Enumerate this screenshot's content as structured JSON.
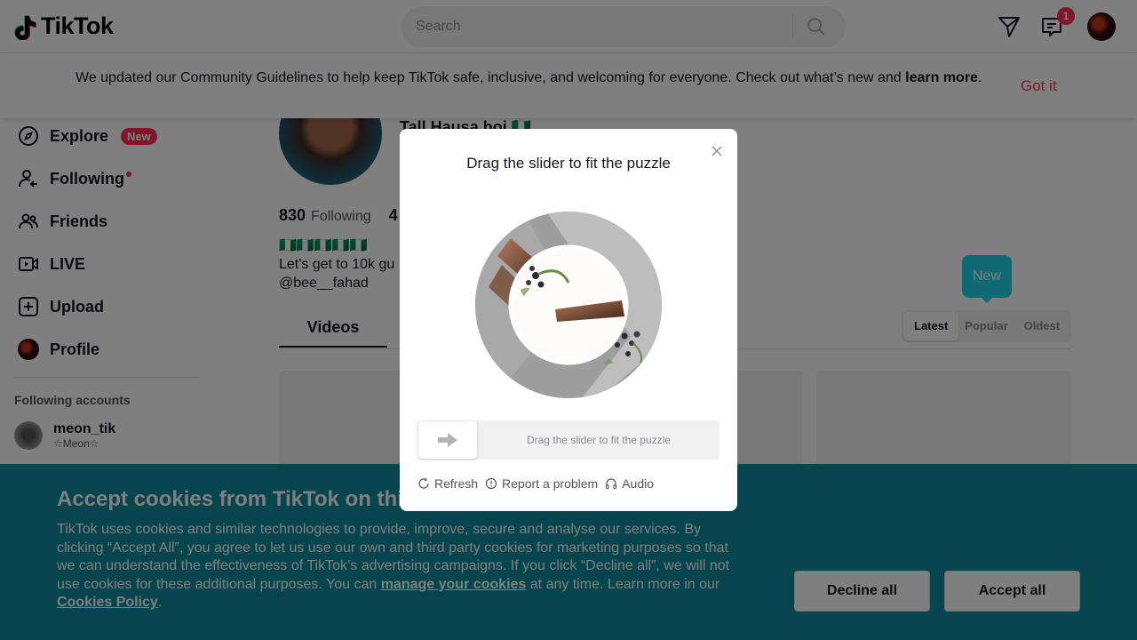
{
  "header": {
    "logo_text": "TikTok",
    "search_placeholder": "Search",
    "inbox_badge": "1"
  },
  "notice": {
    "text": "We updated our Community Guidelines to help keep TikTok safe, inclusive, and welcoming for everyone. Check out what’s new and ",
    "link": "learn more",
    "suffix": ".",
    "dismiss": "Got it"
  },
  "sidebar": {
    "items": [
      {
        "label": "Explore",
        "badge": "New"
      },
      {
        "label": "Following"
      },
      {
        "label": "Friends"
      },
      {
        "label": "LIVE"
      },
      {
        "label": "Upload"
      },
      {
        "label": "Profile"
      }
    ],
    "following_title": "Following accounts",
    "accounts": [
      {
        "name": "meon_tik",
        "sub": "☆Meon☆"
      }
    ]
  },
  "profile": {
    "name": "Tall Hausa boi 🇳🇬",
    "following_count": "830",
    "following_label": "Following",
    "followers_partial": "4",
    "bio_line1": "🇳🇬🇳🇬🇳🇬🇳🇬🇳🇬",
    "bio_line2": "Let's get to 10k gu",
    "bio_line3": "@bee__fahad",
    "tab_videos": "Videos",
    "tooltip_new": "New",
    "sort": [
      "Latest",
      "Popular",
      "Oldest"
    ]
  },
  "captcha": {
    "title": "Drag the slider to fit the puzzle",
    "slider_hint": "Drag the slider to fit the puzzle",
    "actions": [
      "Refresh",
      "Report a problem",
      "Audio"
    ]
  },
  "cookie": {
    "title": "Accept cookies from TikTok on this browser?",
    "text_1": "TikTok uses cookies and similar technologies to provide, improve, secure and analyse our services. By clicking “Accept All”, you agree to let us use our own and third party cookies for marketing purposes so that we can understand the effectiveness of TikTok’s advertising campaigns. If you click “Decline all”, we will not use cookies for these additional purposes. You can ",
    "link_1": "manage your cookies",
    "text_2": " at any time. Learn more in our ",
    "link_2": "Cookies Policy",
    "text_3": ".",
    "decline": "Decline all",
    "accept": "Accept all"
  },
  "colors": {
    "brand_red": "#fe2c55",
    "cookie_bg": "#0c899c",
    "tooltip": "#20d5ec"
  }
}
